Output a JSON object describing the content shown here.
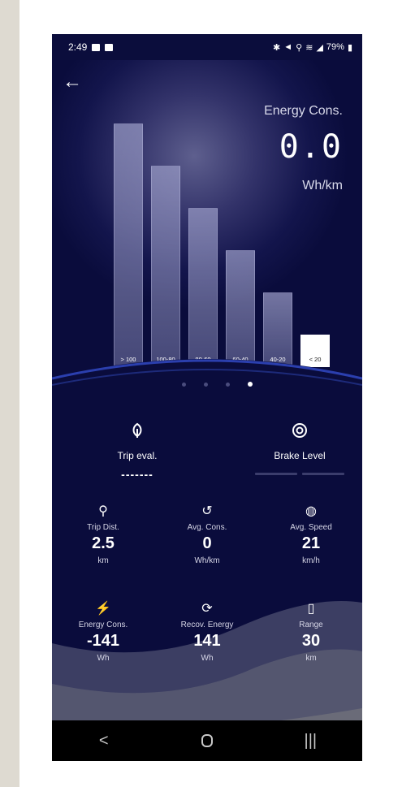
{
  "status_bar": {
    "time": "2:49",
    "battery": "79%"
  },
  "header": {
    "back_icon": "arrow-left-icon",
    "energy_label": "Energy Cons.",
    "energy_value": "0.0",
    "energy_unit": "Wh/km"
  },
  "chart_data": {
    "type": "bar",
    "categories": [
      "> 100",
      "100-80",
      "80-60",
      "60-40",
      "40-20",
      "< 20"
    ],
    "values": [
      100,
      80,
      60,
      40,
      20,
      0
    ],
    "highlighted": "< 20",
    "title": "",
    "xlabel": "",
    "ylabel": ""
  },
  "pager": {
    "count": 4,
    "active": 3
  },
  "trip_eval": {
    "icon": "leaf-icon",
    "label": "Trip eval.",
    "value": "-------"
  },
  "brake": {
    "icon": "target-icon",
    "label": "Brake Level"
  },
  "stats": [
    {
      "icon": "route-icon",
      "label": "Trip Dist.",
      "value": "2.5",
      "unit": "km"
    },
    {
      "icon": "history-bolt-icon",
      "label": "Avg. Cons.",
      "value": "0",
      "unit": "Wh/km"
    },
    {
      "icon": "speedometer-icon",
      "label": "Avg. Speed",
      "value": "21",
      "unit": "km/h"
    },
    {
      "icon": "bolt-icon",
      "label": "Energy Cons.",
      "value": "-141",
      "unit": "Wh"
    },
    {
      "icon": "recover-bolt-icon",
      "label": "Recov. Energy",
      "value": "141",
      "unit": "Wh"
    },
    {
      "icon": "battery-icon",
      "label": "Range",
      "value": "30",
      "unit": "km"
    }
  ],
  "colors": {
    "background": "#0a0c3c",
    "bar": "#8a8cc0",
    "highlight": "#ffffff"
  }
}
